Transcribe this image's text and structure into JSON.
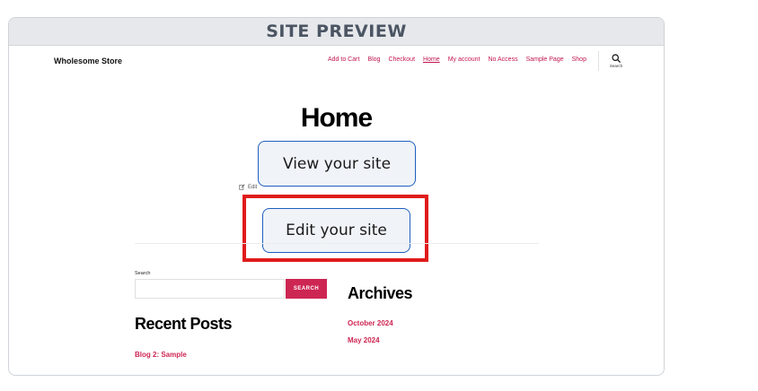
{
  "preview": {
    "title": "SITE PREVIEW"
  },
  "site": {
    "brand": "Wholesome Store",
    "nav": [
      {
        "label": "Add to Cart"
      },
      {
        "label": "Blog"
      },
      {
        "label": "Checkout"
      },
      {
        "label": "Home",
        "current": true
      },
      {
        "label": "My account"
      },
      {
        "label": "No Access"
      },
      {
        "label": "Sample Page"
      },
      {
        "label": "Shop"
      }
    ],
    "search_toggle_label": "Search",
    "page_title": "Home",
    "view_button": "View your site",
    "edit_button": "Edit your site",
    "edit_link": "Edit",
    "search_widget": {
      "label": "Search",
      "input_value": "",
      "button": "SEARCH"
    },
    "recent_posts": {
      "title": "Recent Posts",
      "items": [
        "Blog 2: Sample"
      ]
    },
    "archives": {
      "title": "Archives",
      "items": [
        "October 2024",
        "May 2024"
      ]
    }
  },
  "colors": {
    "accent": "#cd2653",
    "highlight": "#e01b1b",
    "button_border": "#1f5fbf"
  },
  "icons": {
    "search_toggle": "search-icon",
    "edit_link": "edit-pencil-icon"
  }
}
